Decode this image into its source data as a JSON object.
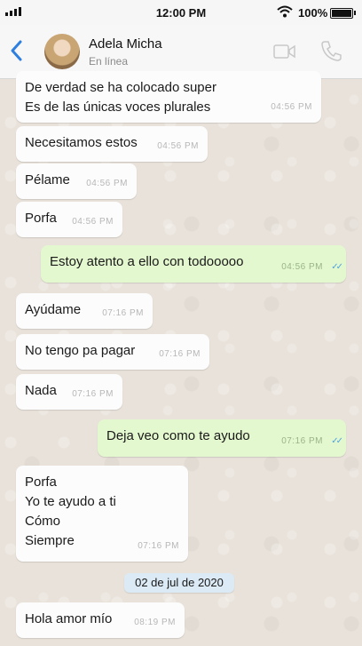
{
  "status_bar": {
    "time": "12:00 PM",
    "battery": "100%"
  },
  "header": {
    "name": "Adela Micha",
    "status": "En línea"
  },
  "messages": [
    {
      "text": "De verdad se ha colocado super\nEs de las únicas voces plurales",
      "time": "04:56 PM",
      "direction": "in"
    },
    {
      "text": "Necesitamos estos",
      "time": "04:56 PM",
      "direction": "in"
    },
    {
      "text": "Pélame",
      "time": "04:56 PM",
      "direction": "in"
    },
    {
      "text": "Porfa",
      "time": "04:56 PM",
      "direction": "in"
    },
    {
      "text": "Estoy atento a ello con todooooo",
      "time": "04:56 PM",
      "direction": "out"
    },
    {
      "text": "Ayúdame",
      "time": "07:16 PM",
      "direction": "in"
    },
    {
      "text": "No tengo pa pagar",
      "time": "07:16 PM",
      "direction": "in"
    },
    {
      "text": "Nada",
      "time": "07:16 PM",
      "direction": "in"
    },
    {
      "text": "Deja veo como te ayudo",
      "time": "07:16 PM",
      "direction": "out"
    },
    {
      "text": "Porfa\nYo te ayudo a ti\nCómo\nSiempre",
      "time": "07:16 PM",
      "direction": "in"
    },
    {
      "text": "Hola amor mío",
      "time": "08:19 PM",
      "direction": "in"
    }
  ],
  "date_separator": "02 de jul de 2020",
  "colors": {
    "incoming": "#fcfcfc",
    "outgoing": "#e4f8cf",
    "accent": "#2f7fe0",
    "read_ticks": "#4fa3e0"
  }
}
